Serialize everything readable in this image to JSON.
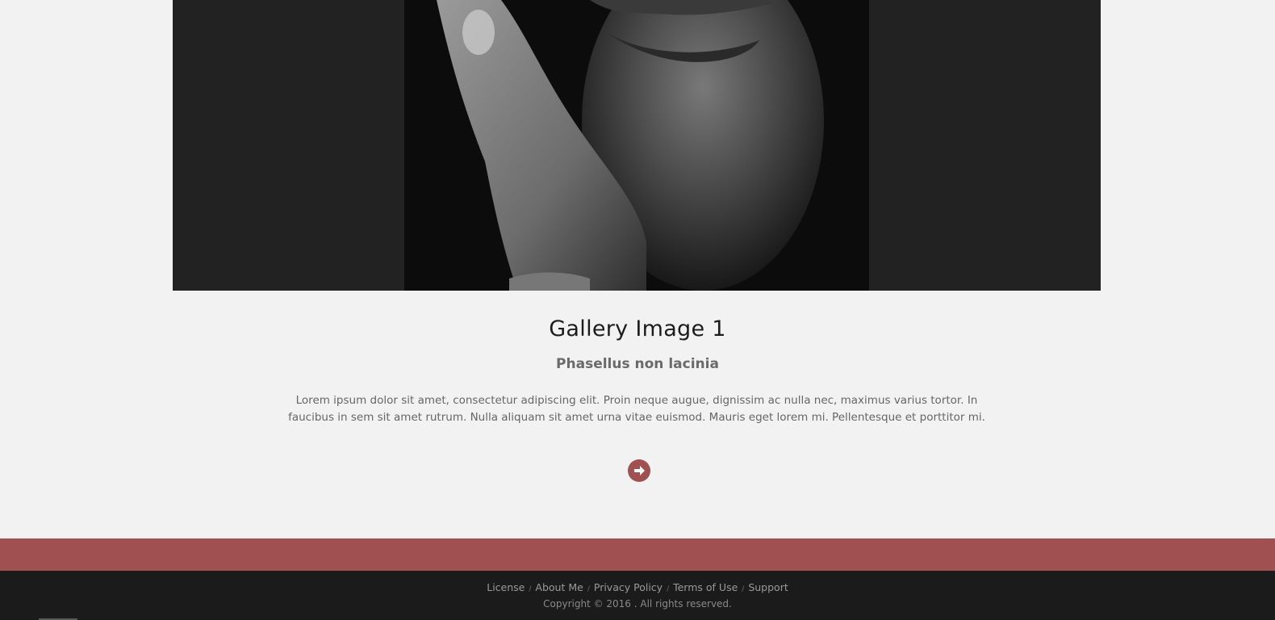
{
  "gallery": {
    "image_alt": "Gallery Image 1",
    "title": "Gallery Image 1",
    "subtitle": "Phasellus non lacinia",
    "description": "Lorem ipsum dolor sit amet, consectetur adipiscing elit. Proin neque augue, dignissim ac nulla nec, maximus varius tortor. In faucibus in sem sit amet rutrum. Nulla aliquam sit amet urna vitae euismod. Mauris eget lorem mi. Pellentesque et porttitor mi.",
    "next_icon": "arrow-circle-right-icon"
  },
  "colors": {
    "accent": "#a05050",
    "footer_bg": "#1b1b1b",
    "hero_bg": "#222222",
    "page_bg": "#f2f2f2"
  },
  "footer": {
    "links": [
      "License",
      "About Me",
      "Privacy Policy",
      "Terms of Use",
      "Support"
    ],
    "separator": "/",
    "copyright": "Copyright © 2016 . All rights reserved."
  }
}
